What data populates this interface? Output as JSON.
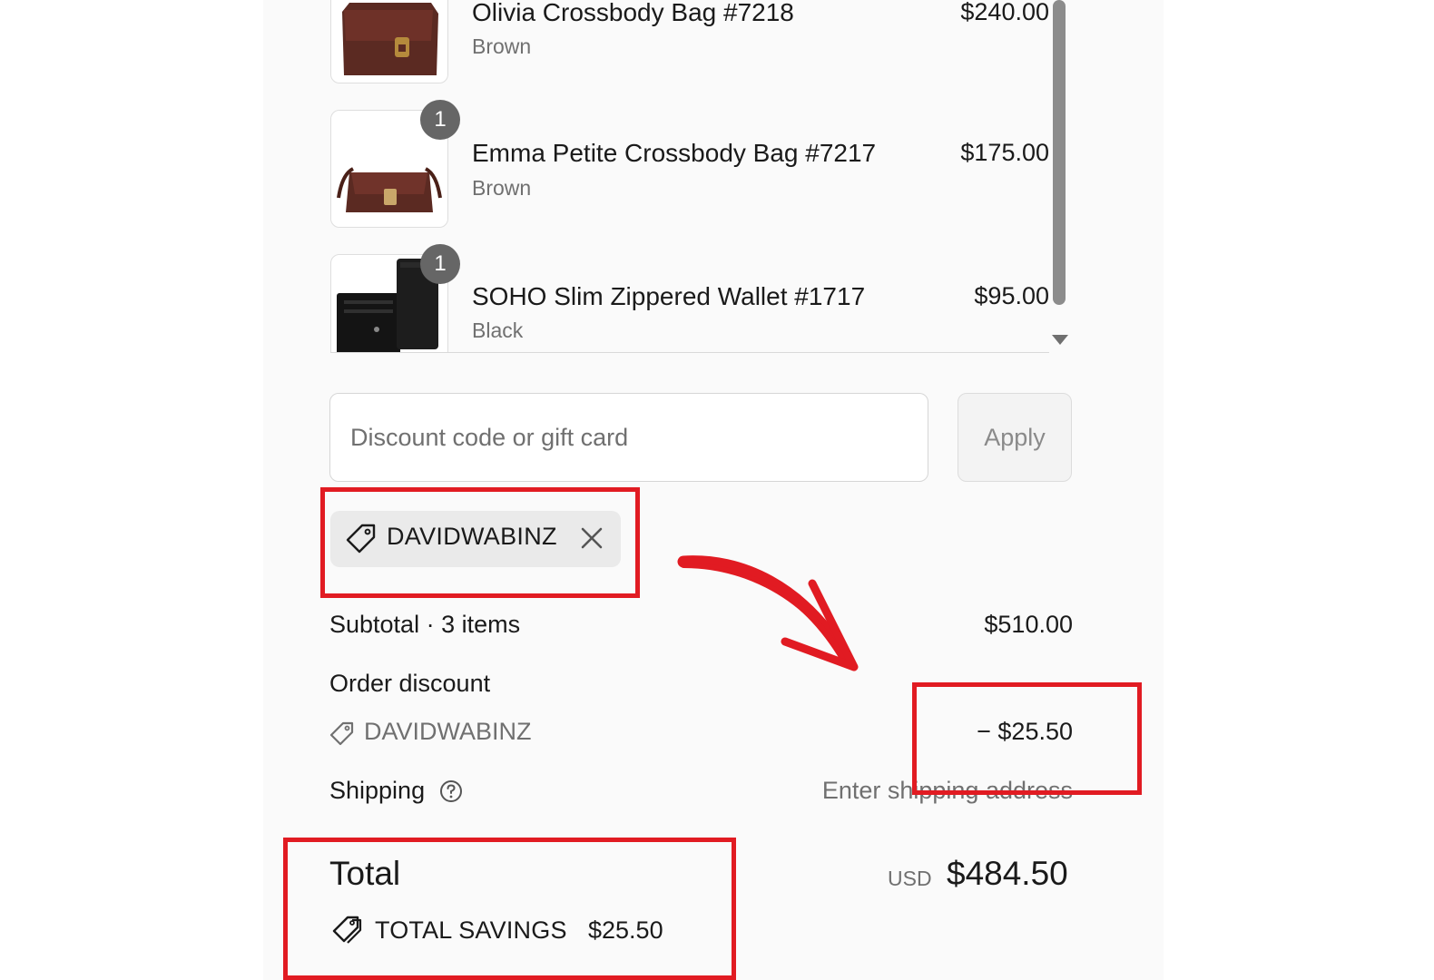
{
  "cart": {
    "items": [
      {
        "name": "Olivia Crossbody Bag #7218",
        "variant": "Brown",
        "price": "$240.00",
        "quantity": ""
      },
      {
        "name": "Emma Petite Crossbody Bag #7217",
        "variant": "Brown",
        "price": "$175.00",
        "quantity": "1"
      },
      {
        "name": "SOHO Slim Zippered Wallet #1717",
        "variant": "Black",
        "price": "$95.00",
        "quantity": "1"
      }
    ]
  },
  "discount": {
    "placeholder": "Discount code or gift card",
    "apply_label": "Apply",
    "applied_code": "DAVIDWABINZ"
  },
  "summary": {
    "subtotal_label": "Subtotal · 3 items",
    "subtotal_value": "$510.00",
    "order_discount_label": "Order discount",
    "discount_code": "DAVIDWABINZ",
    "discount_value": "− $25.50",
    "shipping_label": "Shipping",
    "shipping_value": "Enter shipping address",
    "total_label": "Total",
    "currency": "USD",
    "total_value": "$484.50",
    "savings_label": "TOTAL SAVINGS",
    "savings_value": "$25.50"
  },
  "colors": {
    "annotation": "#e11b22",
    "panel_bg": "#fafafa",
    "muted_text": "#707070"
  },
  "icons": [
    "tag-icon",
    "close-icon",
    "help-circle-icon",
    "savings-tag-icon",
    "scroll-down-arrow-icon",
    "annotation-arrow"
  ]
}
